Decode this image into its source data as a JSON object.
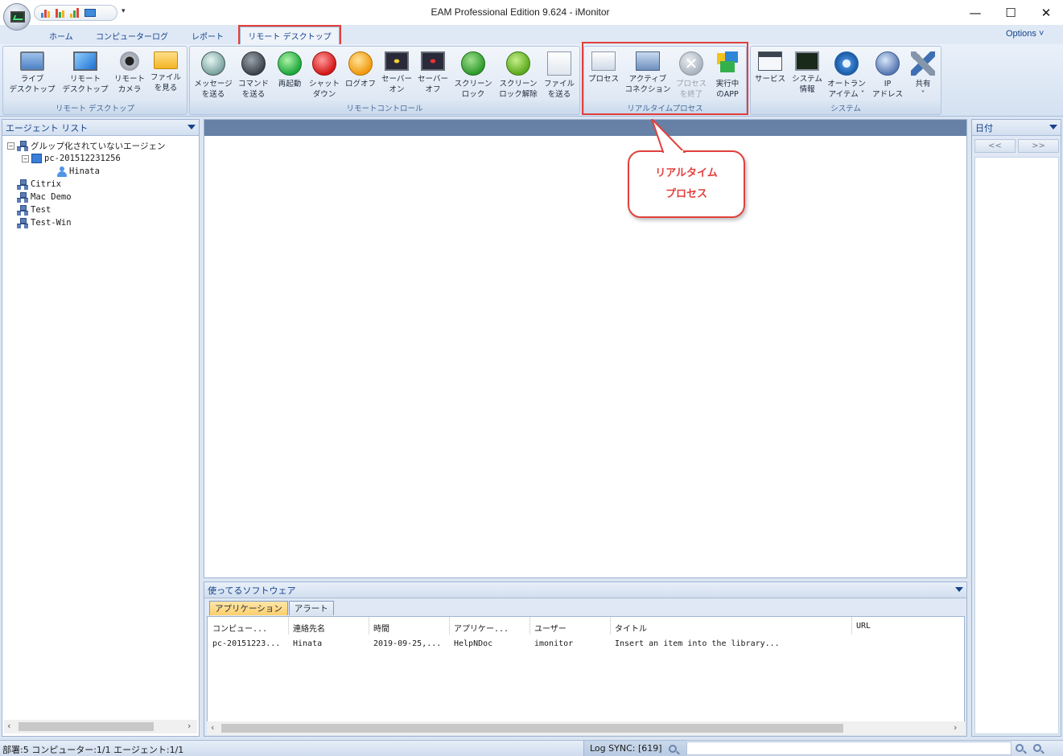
{
  "window": {
    "title": "EAM Professional Edition 9.624 - iMonitor",
    "minimize": "—",
    "maximize": "☐",
    "close": "✕"
  },
  "ribbon_tabs": [
    {
      "label": "ホーム"
    },
    {
      "label": "コンピューターログ"
    },
    {
      "label": "レポート"
    },
    {
      "label": "リモート デスクトップ",
      "active": true
    }
  ],
  "options_label": "Options ˅",
  "groups": {
    "remote_desktop": {
      "label": "リモート デスクトップ",
      "buttons": [
        "ライブ\nデスクトップ",
        "リモート\nデスクトップ",
        "リモート\nカメラ",
        "ファイル\nを見る"
      ]
    },
    "remote_control": {
      "label": "リモートコントロール",
      "buttons": [
        "メッセージ\nを送る",
        "コマンド\nを送る",
        "再起動",
        "シャット\nダウン",
        "ログオフ",
        "セーバー\nオン",
        "セーバー\nオフ",
        "スクリーン\nロック",
        "スクリーン\nロック解除",
        "ファイル\nを送る"
      ]
    },
    "realtime_process": {
      "label": "リアルタイムプロセス",
      "buttons": [
        "プロセス",
        "アクティブ\nコネクション",
        "プロセス\nを終了",
        "実行中\nのAPP"
      ]
    },
    "system": {
      "label": "システム",
      "buttons": [
        "サービス",
        "システム\n情報",
        "オートラン\nアイテム ˅",
        "IP\nアドレス",
        "共有\n˅"
      ]
    }
  },
  "callout": {
    "line1": "リアルタイム",
    "line2": "プロセス"
  },
  "agent_panel": {
    "title": "エージェント リスト",
    "tree": [
      {
        "label": "グルップ化されていないエージェン"
      },
      {
        "label": "pc-201512231256"
      },
      {
        "label": "Hinata"
      },
      {
        "label": "Citrix"
      },
      {
        "label": "Mac Demo"
      },
      {
        "label": "Test"
      },
      {
        "label": "Test-Win"
      }
    ]
  },
  "software_panel": {
    "title": "使ってるソフトウェア",
    "tabs": [
      "アプリケーション",
      "アラート"
    ],
    "columns": [
      "コンピュー...",
      "連絡先名",
      "時間",
      "アプリケー...",
      "ユーザー",
      "タイトル",
      "URL"
    ],
    "rows": [
      [
        "pc-20151223...",
        "Hinata",
        "2019-09-25,...",
        "HelpNDoc",
        "imonitor",
        "Insert an item into the library...",
        ""
      ]
    ]
  },
  "date_panel": {
    "title": "日付",
    "prev": "<<",
    "next": ">>"
  },
  "status": {
    "left": "部署:5 コンピューター:1/1 エージェント:1/1",
    "log_sync": "Log SYNC: [619]"
  },
  "colors": {
    "accent_red": "#e2403d",
    "ribbon_text": "#15428b"
  }
}
